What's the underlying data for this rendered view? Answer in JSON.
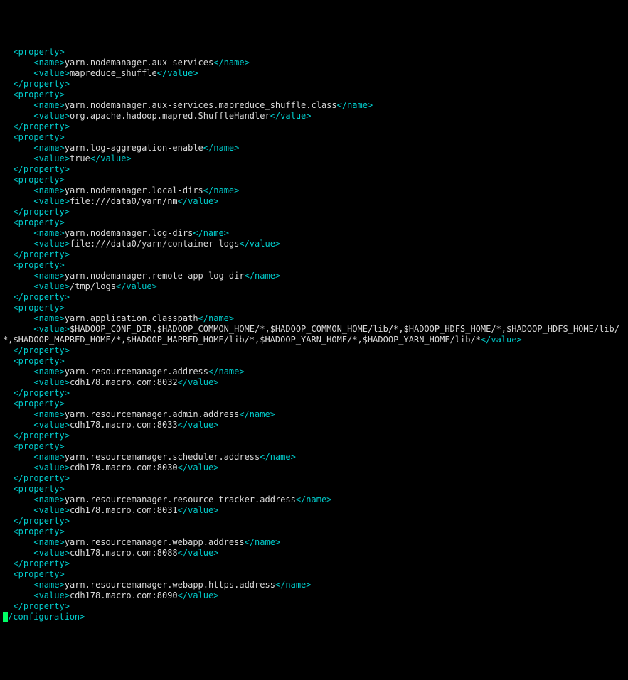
{
  "tags": {
    "prop_open": "<property>",
    "prop_close": "</property>",
    "name_open": "<name>",
    "name_close": "</name>",
    "value_open": "<value>",
    "value_close": "</value>",
    "config_close": "/configuration>"
  },
  "indent": {
    "l1": "  ",
    "l2": "      "
  },
  "props": [
    {
      "name": "yarn.nodemanager.aux-services",
      "value": "mapreduce_shuffle"
    },
    {
      "name": "yarn.nodemanager.aux-services.mapreduce_shuffle.class",
      "value": "org.apache.hadoop.mapred.ShuffleHandler"
    },
    {
      "name": "yarn.log-aggregation-enable",
      "value": "true"
    },
    {
      "name": "yarn.nodemanager.local-dirs",
      "value": "file:///data0/yarn/nm"
    },
    {
      "name": "yarn.nodemanager.log-dirs",
      "value": "file:///data0/yarn/container-logs"
    },
    {
      "name": "yarn.nodemanager.remote-app-log-dir",
      "value": "/tmp/logs"
    },
    {
      "name": "yarn.application.classpath",
      "value": "$HADOOP_CONF_DIR,$HADOOP_COMMON_HOME/*,$HADOOP_COMMON_HOME/lib/*,$HADOOP_HDFS_HOME/*,$HADOOP_HDFS_HOME/lib/*,$HADOOP_MAPRED_HOME/*,$HADOOP_MAPRED_HOME/lib/*,$HADOOP_YARN_HOME/*,$HADOOP_YARN_HOME/lib/*"
    },
    {
      "name": "yarn.resourcemanager.address",
      "value": "cdh178.macro.com:8032"
    },
    {
      "name": "yarn.resourcemanager.admin.address",
      "value": "cdh178.macro.com:8033"
    },
    {
      "name": "yarn.resourcemanager.scheduler.address",
      "value": "cdh178.macro.com:8030"
    },
    {
      "name": "yarn.resourcemanager.resource-tracker.address",
      "value": "cdh178.macro.com:8031"
    },
    {
      "name": "yarn.resourcemanager.webapp.address",
      "value": "cdh178.macro.com:8088"
    },
    {
      "name": "yarn.resourcemanager.webapp.https.address",
      "value": "cdh178.macro.com:8090"
    }
  ]
}
